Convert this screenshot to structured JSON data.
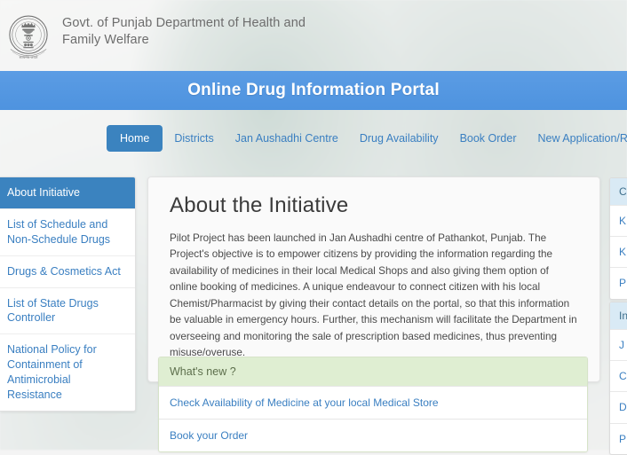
{
  "header": {
    "emblem_alt": "Government of India emblem - Ashoka Lion Capital",
    "title": "Govt. of Punjab Department of Health and Family Welfare"
  },
  "banner": {
    "title": "Online Drug Information Portal",
    "background_color": "#5599e2"
  },
  "nav": {
    "active_color": "#3b83bf",
    "link_color": "#3a7fc1",
    "items": [
      {
        "label": "Home",
        "active": true
      },
      {
        "label": "Districts",
        "active": false
      },
      {
        "label": "Jan Aushadhi Centre",
        "active": false
      },
      {
        "label": "Drug Availability",
        "active": false
      },
      {
        "label": "Book Order",
        "active": false
      },
      {
        "label": "New Application/Renewal of Licens",
        "active": false
      }
    ]
  },
  "sidebar": {
    "items": [
      {
        "label": "About Initiative",
        "active": true
      },
      {
        "label": "List of Schedule and Non-Schedule Drugs",
        "active": false
      },
      {
        "label": "Drugs & Cosmetics Act",
        "active": false
      },
      {
        "label": "List of State Drugs Controller",
        "active": false
      },
      {
        "label": "National Policy for Containment of Antimicrobial Resistance",
        "active": false
      }
    ]
  },
  "main": {
    "heading": "About the Initiative",
    "body": "Pilot Project has been launched in Jan Aushadhi centre of Pathankot, Punjab. The Project's objective is to empower citizens by providing the information regarding the availability of medicines in their local Medical Shops and also giving them option of online booking of medicines. A unique endeavour to connect citizen with his local Chemist/Pharmacist by giving their contact details on the portal, so that this information be valuable in emergency hours. Further, this mechanism will facilitate the Department in overseeing and monitoring the sale of prescription based medicines, thus preventing misuse/overuse."
  },
  "whats_new": {
    "header": "What's new ?",
    "header_background": "#dfeed2",
    "items": [
      {
        "label": "Check Availability of Medicine at your local Medical Store"
      },
      {
        "label": "Book your Order"
      }
    ]
  },
  "right_panels": [
    {
      "header": "C",
      "header_background": "#d9eaf5",
      "items": [
        {
          "label": "K"
        },
        {
          "label": "K"
        },
        {
          "label": "P"
        }
      ]
    },
    {
      "header": "In",
      "header_background": "#d9eaf5",
      "items": [
        {
          "label": "J"
        },
        {
          "label": "C"
        },
        {
          "label": "D\nF"
        },
        {
          "label": "P\ns"
        }
      ]
    }
  ]
}
